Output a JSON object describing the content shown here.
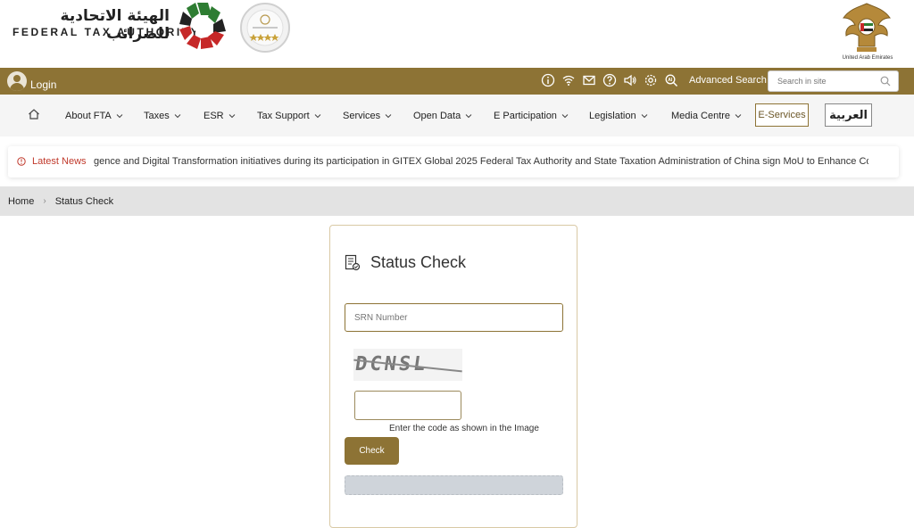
{
  "header": {
    "brand_ar": "الهيئة الاتحادية للضرائب",
    "brand_en": "FEDERAL TAX AUTHORITY",
    "emblem_caption": "United Arab Emirates"
  },
  "topbar": {
    "login_label": "Login",
    "advanced_search": "Advanced Search",
    "search_placeholder": "Search in site",
    "tools": [
      "info-icon",
      "wifi-icon",
      "mail-icon",
      "help-icon",
      "speaker-icon",
      "settings-icon",
      "accessibility-search-icon"
    ]
  },
  "nav": {
    "items": [
      "About FTA",
      "Taxes",
      "ESR",
      "Tax Support",
      "Services",
      "Open Data",
      "E Participation",
      "Legislation",
      "Media Centre"
    ],
    "eservices": "E-Services",
    "arabic": "العربية"
  },
  "news": {
    "label": "Latest News",
    "ticker": "gence and Digital Transformation initiatives during its participation in GITEX Global 2025   Federal Tax Authority and State Taxation Administration of China sign MoU to Enhance Cooperation and Ex"
  },
  "breadcrumb": {
    "home": "Home",
    "current": "Status Check"
  },
  "form": {
    "title": "Status Check",
    "srn_placeholder": "SRN Number",
    "captcha_text": "DCNSL",
    "hint": "Enter the code as shown in the Image",
    "check_label": "Check"
  },
  "colors": {
    "brand": "#8d7335",
    "nav_bg": "#f5f5f5",
    "crumb_bg": "#e3e3e3",
    "news_label": "#c0392b"
  }
}
